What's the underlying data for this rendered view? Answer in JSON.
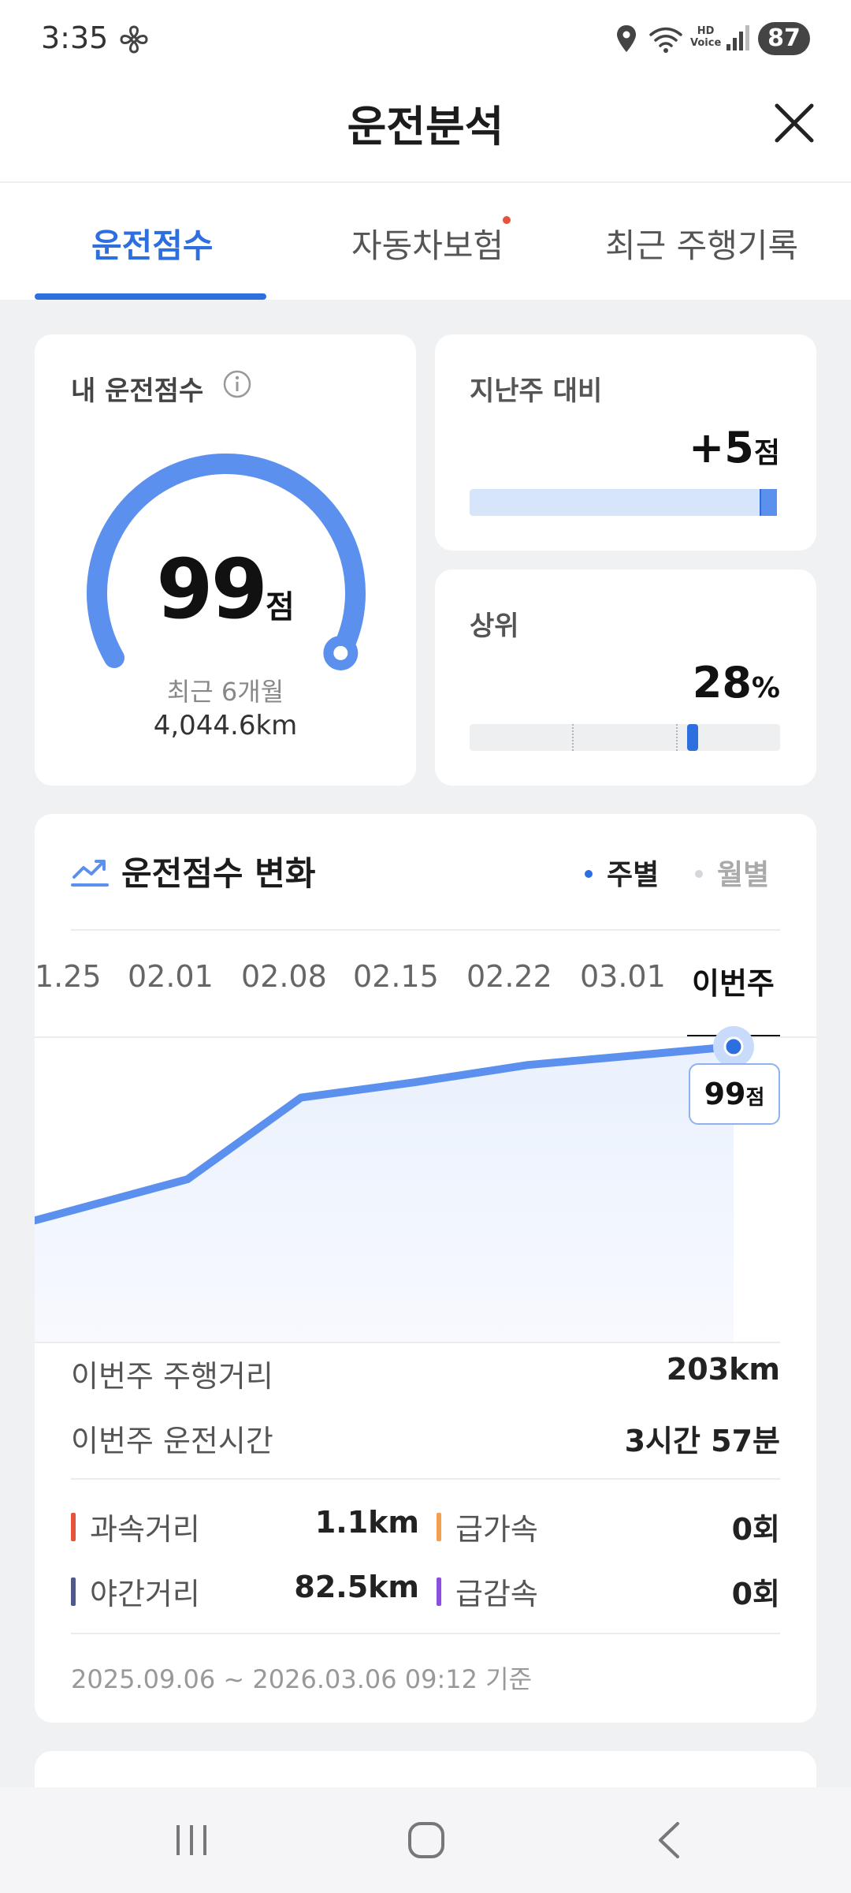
{
  "status": {
    "time": "3:35",
    "battery": "87",
    "hd_top": "HD",
    "hd_bottom": "Voice"
  },
  "header": {
    "title": "운전분석"
  },
  "tabs": [
    {
      "label": "운전점수",
      "active": true
    },
    {
      "label": "자동차보험",
      "active": false,
      "badge": true
    },
    {
      "label": "최근 주행기록",
      "active": false
    }
  ],
  "score_card": {
    "label": "내 운전점수",
    "score": "99",
    "score_unit": "점",
    "score_value": 99,
    "period": "최근 6개월",
    "distance": "4,044.6km"
  },
  "week_compare": {
    "label": "지난주 대비",
    "value": "+5",
    "unit": "점"
  },
  "rank": {
    "label": "상위",
    "value": "28",
    "unit": "%"
  },
  "trend": {
    "title": "운전점수 변화",
    "toggle_week": "주별",
    "toggle_month": "월별",
    "weeks": [
      "1.25",
      "02.01",
      "02.08",
      "02.15",
      "02.22",
      "03.01",
      "이번주"
    ],
    "tooltip_value": "99",
    "tooltip_unit": "점"
  },
  "chart_data": {
    "type": "area",
    "categories": [
      "1.25",
      "02.01",
      "02.08",
      "02.15",
      "02.22",
      "03.01",
      "이번주"
    ],
    "values": [
      80,
      83,
      86,
      94,
      95.5,
      97.2,
      99
    ],
    "ylim": [
      70,
      100
    ],
    "grid": false,
    "title": "",
    "xlabel": "",
    "ylabel": ""
  },
  "stats": {
    "weekly_distance_label": "이번주 주행거리",
    "weekly_distance": "203km",
    "weekly_time_label": "이번주 운전시간",
    "weekly_time": "3시간 57분",
    "overspeed_label": "과속거리",
    "overspeed": "1.1km",
    "accel_label": "급가속",
    "accel": "0회",
    "night_label": "야간거리",
    "night": "82.5km",
    "decel_label": "급감속",
    "decel": "0회",
    "basis": "2025.09.06 ~ 2026.03.06 09:12 기준"
  },
  "colors": {
    "accent": "#2e6fe0",
    "overspeed": "#e4533a",
    "accel": "#f2a04e",
    "night": "#4f5a8a",
    "decel": "#8a4fe0"
  }
}
